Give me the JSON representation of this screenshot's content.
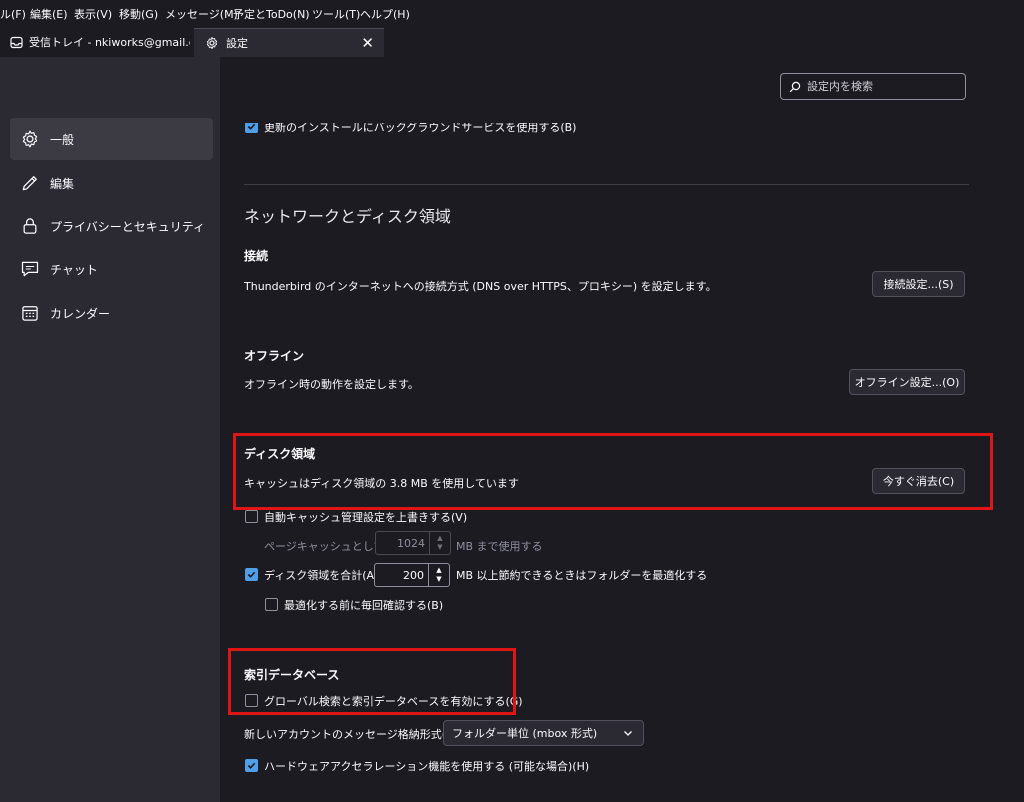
{
  "menubar": [
    "ル(F)",
    "編集(E)",
    "表示(V)",
    "移動(G)",
    "メッセージ(M)",
    "予定とToDo(N)",
    "ツール(T)",
    "ヘルプ(H)"
  ],
  "tabs": {
    "inbox": "受信トレイ - nkiworks@gmail.com",
    "settings": "設定",
    "close": "✕"
  },
  "sidebar": {
    "items": [
      {
        "label": "一般",
        "icon": "gear-icon"
      },
      {
        "label": "編集",
        "icon": "pencil-icon"
      },
      {
        "label": "プライバシーとセキュリティ",
        "icon": "lock-icon"
      },
      {
        "label": "チャット",
        "icon": "chat-icon"
      },
      {
        "label": "カレンダー",
        "icon": "calendar-icon"
      }
    ]
  },
  "search": {
    "placeholder": "設定内を検索"
  },
  "top_cut_label": "更新のインストールにバックグラウンドサービスを使用する(B)",
  "network": {
    "title": "ネットワークとディスク領域",
    "connection": {
      "heading": "接続",
      "description": "Thunderbird のインターネットへの接続方式 (DNS over HTTPS、プロキシー) を設定します。",
      "button": "接続設定...(S)"
    },
    "offline": {
      "heading": "オフライン",
      "description": "オフライン時の動作を設定します。",
      "button": "オフライン設定...(O)"
    },
    "disk": {
      "heading": "ディスク領域",
      "description": "キャッシュはディスク領域の 3.8 MB を使用しています",
      "button": "今すぐ消去(C)",
      "override_label": "自動キャッシュ管理設定を上書きする(V)",
      "override_checked": false,
      "page_cache_label": "ページキャッシュとして(U)",
      "page_cache_value": "1024",
      "page_cache_suffix": "MB まで使用する",
      "compact_label": "ディスク領域を合計(A)",
      "compact_checked": true,
      "compact_value": "200",
      "compact_suffix": "MB 以上節約できるときはフォルダーを最適化する",
      "confirm_label": "最適化する前に毎回確認する(B)",
      "confirm_checked": false
    }
  },
  "index": {
    "heading": "索引データベース",
    "global_search_label": "グローバル検索と索引データベースを有効にする(G)",
    "global_search_checked": false,
    "store_type_label": "新しいアカウントのメッセージ格納形式(T):",
    "store_type_value": "フォルダー単位 (mbox 形式)",
    "hw_accel_label": "ハードウェアアクセラレーション機能を使用する (可能な場合)(H)",
    "hw_accel_checked": true
  },
  "colors": {
    "background": "#1c1b22",
    "sidebar": "#2b2a33",
    "accent": "#4f9ee8",
    "highlight_box": "#e01515"
  }
}
